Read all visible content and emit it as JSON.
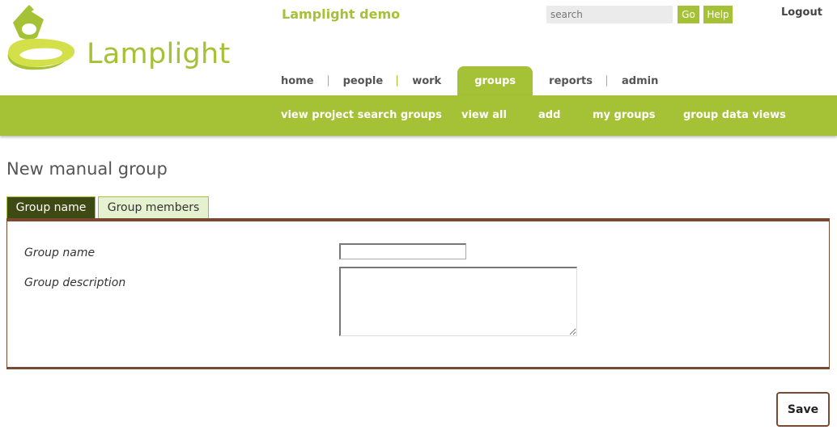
{
  "header": {
    "app_title": "Lamplight demo",
    "logo_text": "Lamplight",
    "search_placeholder": "search",
    "go_label": "Go",
    "help_label": "Help",
    "logout_label": "Logout"
  },
  "main_nav": {
    "items": [
      {
        "label": "home"
      },
      {
        "label": "people"
      },
      {
        "label": "work"
      },
      {
        "label": "groups"
      },
      {
        "label": "reports"
      },
      {
        "label": "admin"
      }
    ],
    "active": "groups"
  },
  "sub_nav": {
    "items": [
      {
        "label": "view project search groups"
      },
      {
        "label": "view all"
      },
      {
        "label": "add"
      },
      {
        "label": "my groups"
      },
      {
        "label": "group data views"
      }
    ]
  },
  "page": {
    "title": "New manual group",
    "tabs": [
      {
        "label": "Group name"
      },
      {
        "label": "Group members"
      }
    ],
    "form": {
      "group_name_label": "Group name",
      "group_name_value": "",
      "group_description_label": "Group description",
      "group_description_value": ""
    },
    "save_label": "Save"
  },
  "colors": {
    "brand_green": "#a5c136",
    "dark_green_tab": "#3e4a14",
    "light_green_tab": "#e6f2cf",
    "panel_border_brown": "#7a4a30"
  },
  "icons": {
    "logo": "lamp-logo-icon"
  }
}
